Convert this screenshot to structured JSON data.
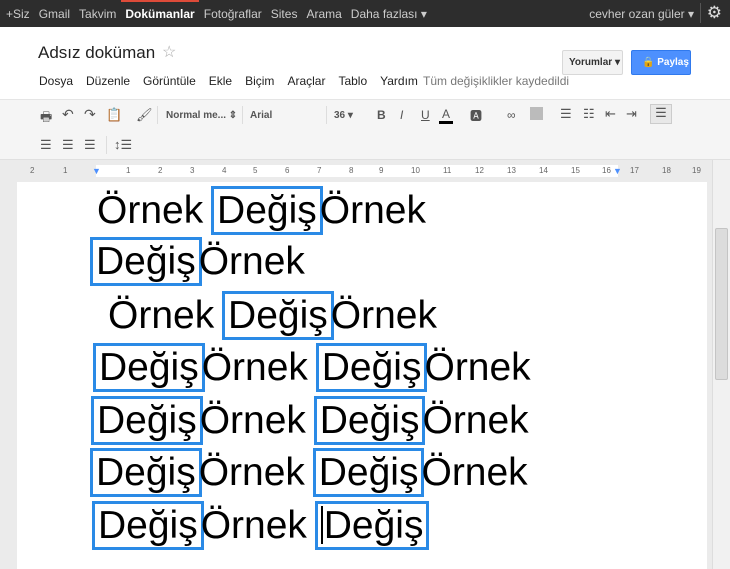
{
  "topbar": {
    "items": [
      "+Siz",
      "Gmail",
      "Takvim",
      "Dokümanlar",
      "Fotoğraflar",
      "Sites",
      "Arama",
      "Daha fazlası ▾"
    ],
    "active": "Dokümanlar",
    "user": "cevher ozan güler ▾",
    "settings_icon": "gear-icon"
  },
  "doc": {
    "title": "Adsız doküman",
    "star": "☆",
    "menu": [
      "Dosya",
      "Düzenle",
      "Görüntüle",
      "Ekle",
      "Biçim",
      "Araçlar",
      "Tablo",
      "Yardım"
    ],
    "saved_status": "Tüm değişiklikler kaydedildi",
    "comments_label": "Yorumlar ▾",
    "share_label": "🔒 Paylaş",
    "share_color": "#4d90fe"
  },
  "toolbar": {
    "style": "Normal me... ⇕",
    "font": "Arial",
    "font_size": "36 ▾"
  },
  "ruler": {
    "labels": [
      "2",
      "1",
      "1",
      "2",
      "3",
      "4",
      "5",
      "6",
      "7",
      "8",
      "9",
      "10",
      "11",
      "12",
      "13",
      "14",
      "15",
      "16",
      "17",
      "18",
      "19"
    ]
  },
  "content": {
    "highlight_color": "#2a8ae6",
    "word_a": "Örnek",
    "word_b": "Değiş",
    "lines": [
      [
        "Örnek ",
        "Değiş",
        "Örnek"
      ],
      [
        "",
        "Değiş",
        "Örnek"
      ],
      [
        "Örnek ",
        "Değiş",
        "Örnek"
      ],
      [
        "",
        "Değiş",
        "Örnek ",
        "Değiş",
        "Örnek"
      ],
      [
        "",
        "Değiş",
        "Örnek ",
        "Değiş",
        "Örnek"
      ],
      [
        "",
        "Değiş",
        "Örnek ",
        "Değiş",
        "Örnek"
      ],
      [
        "",
        "Değiş",
        "Örnek ",
        "Değiş",
        ""
      ]
    ]
  }
}
